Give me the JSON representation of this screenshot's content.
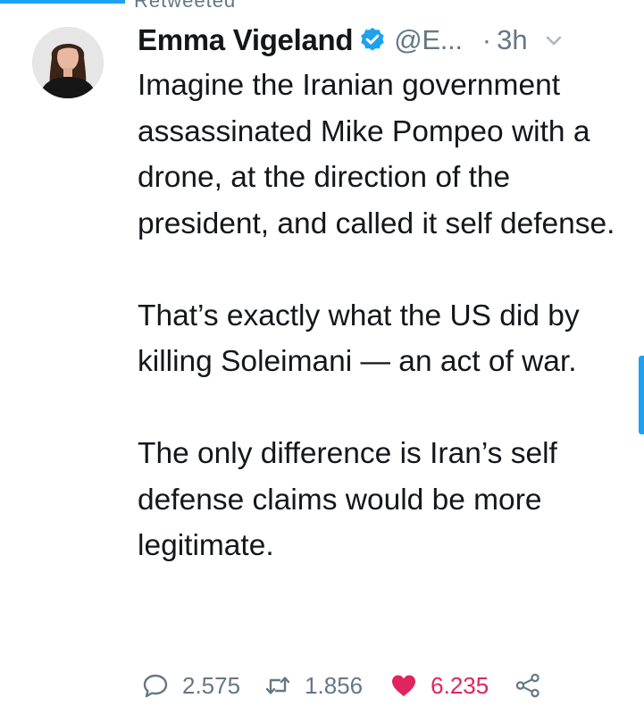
{
  "header_fragment": "Retweeted",
  "tweet": {
    "author_name": "Emma Vigeland",
    "handle": "@E...",
    "separator": "·",
    "time": "3h",
    "paragraphs": [
      "Imagine the Iranian government assassinated Mike Pompeo with a drone, at the direction of the president, and called it self defense.",
      "That’s exactly what the US did by killing Soleimani — an act of war.",
      "The only difference is Iran’s self defense claims would be more legitimate."
    ],
    "replies": "2.575",
    "retweets": "1.856",
    "likes": "6.235"
  },
  "icons": {
    "verified": "verified-badge-icon",
    "caret": "chevron-down-icon",
    "reply": "reply-bubble-icon",
    "retweet": "retweet-icon",
    "like": "heart-icon",
    "share": "share-icon"
  },
  "colors": {
    "accent": "#1da1f2",
    "text": "#14171a",
    "muted": "#657786",
    "like": "#e0245e"
  }
}
